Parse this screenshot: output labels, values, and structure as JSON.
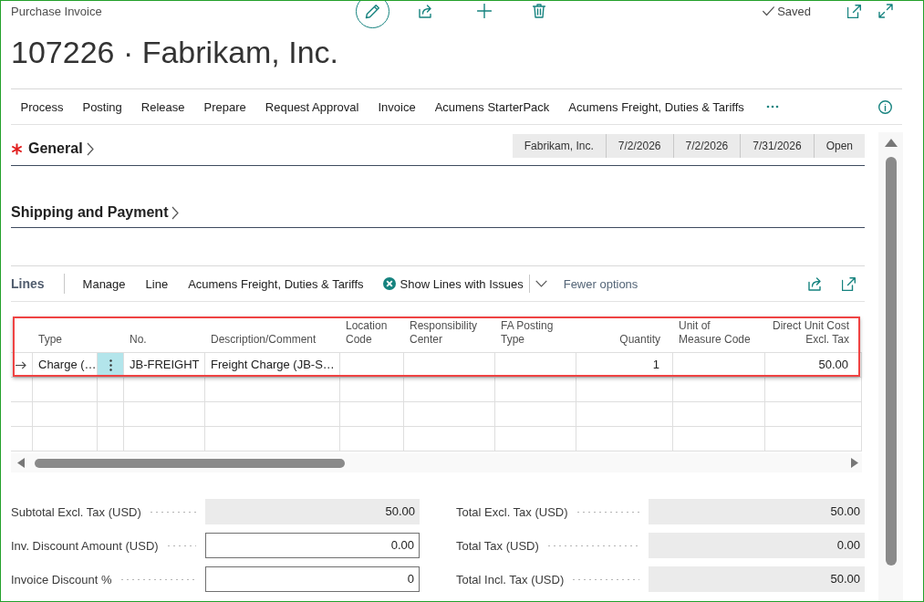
{
  "page": {
    "caption": "Purchase Invoice",
    "title": "107226 · Fabrikam, Inc.",
    "status": "Saved"
  },
  "action_menu": [
    "Process",
    "Posting",
    "Release",
    "Prepare",
    "Request Approval",
    "Invoice",
    "Acumens StarterPack",
    "Acumens Freight, Duties & Tariffs"
  ],
  "sections": [
    {
      "title": "General",
      "required": true,
      "summary": [
        "Fabrikam, Inc.",
        "7/2/2026",
        "7/2/2026",
        "7/31/2026",
        "Open"
      ]
    },
    {
      "title": "Shipping and Payment",
      "required": false
    }
  ],
  "lines": {
    "title": "Lines",
    "actions": [
      {
        "label": "Manage",
        "kind": "menu"
      },
      {
        "label": "Line",
        "kind": "menu"
      },
      {
        "label": "Acumens Freight, Duties & Tariffs",
        "kind": "menu"
      },
      {
        "label": "Show Lines with Issues",
        "kind": "split"
      },
      {
        "label": "Fewer options",
        "kind": "link"
      }
    ],
    "table": {
      "columns": [
        {
          "label": "Type",
          "kind": "text",
          "values": [
            "Charge (…"
          ]
        },
        {
          "label": "No.",
          "kind": "text",
          "values": [
            "JB-FREIGHT"
          ]
        },
        {
          "label": "Description/Comment",
          "kind": "text",
          "values": [
            "Freight Charge (JB-S…"
          ]
        },
        {
          "label": "Location Code",
          "kind": "text"
        },
        {
          "label": "Responsibility Center",
          "kind": "text"
        },
        {
          "label": "FA Posting Type",
          "kind": "text"
        },
        {
          "label": "Quantity",
          "kind": "number",
          "values": [
            "1"
          ]
        },
        {
          "label": "Unit of Measure Code",
          "kind": "text"
        },
        {
          "label": "Direct Unit Cost Excl. Tax",
          "kind": "number",
          "values": [
            "50.00"
          ]
        }
      ],
      "rows": [
        {
          "selected": true
        },
        {
          "selected": false
        },
        {
          "selected": false
        },
        {
          "selected": false
        }
      ]
    }
  },
  "totals": {
    "left": [
      {
        "label": "Subtotal Excl. Tax (USD)",
        "value": "50.00",
        "editable": false
      },
      {
        "label": "Inv. Discount Amount (USD)",
        "value": "0.00",
        "editable": true
      },
      {
        "label": "Invoice Discount %",
        "value": "0",
        "editable": true
      }
    ],
    "right": [
      {
        "label": "Total Excl. Tax (USD)",
        "value": "50.00",
        "editable": false
      },
      {
        "label": "Total Tax (USD)",
        "value": "0.00",
        "editable": false
      },
      {
        "label": "Total Incl. Tax (USD)",
        "value": "50.00",
        "editable": false
      }
    ]
  }
}
